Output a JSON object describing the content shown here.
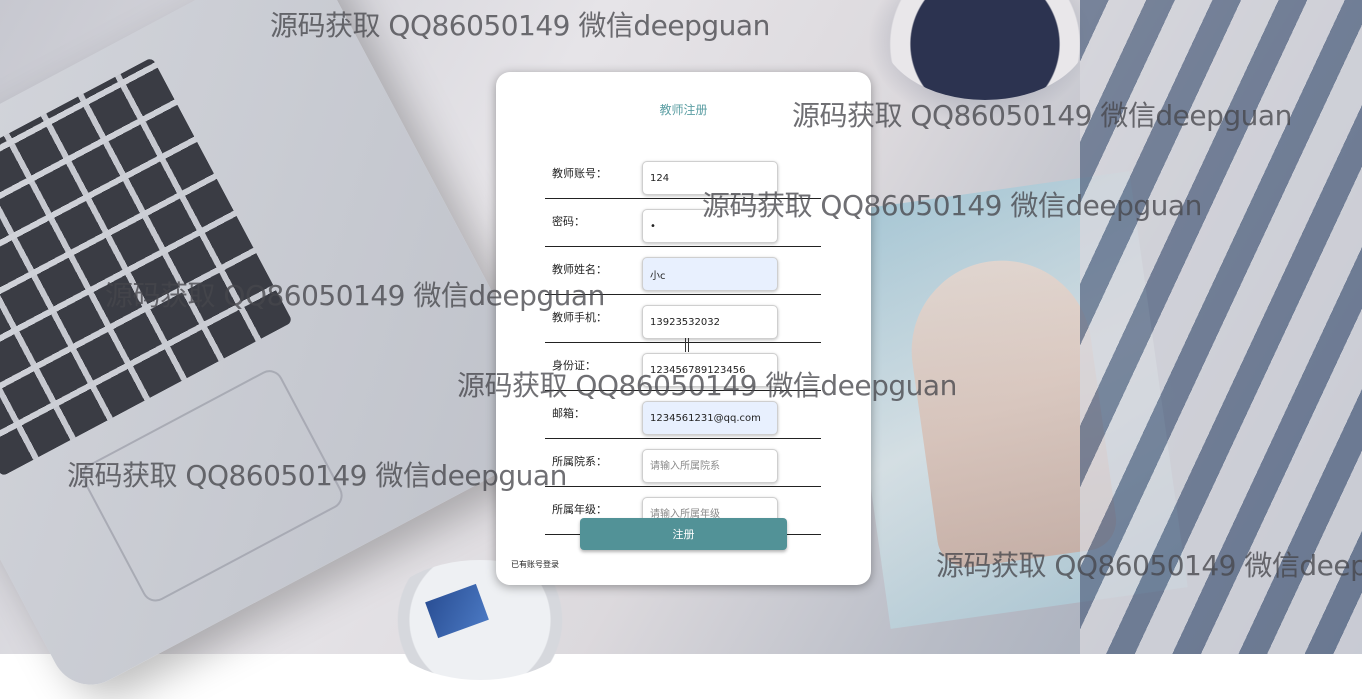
{
  "form": {
    "title": "教师注册",
    "fields": [
      {
        "label": "教师账号：",
        "value": "124",
        "placeholder": "",
        "type": "text"
      },
      {
        "label": "密码：",
        "value": "•",
        "placeholder": "",
        "type": "text"
      },
      {
        "label": "教师姓名：",
        "value": "小c",
        "placeholder": "",
        "type": "text"
      },
      {
        "label": "教师手机：",
        "value": "13923532032",
        "placeholder": "",
        "type": "text"
      },
      {
        "label": "身份证：",
        "value": "123456789123456",
        "placeholder": "",
        "type": "text"
      },
      {
        "label": "邮箱：",
        "value": "1234561231@qq.com",
        "placeholder": "",
        "type": "text"
      },
      {
        "label": "所属院系：",
        "value": "",
        "placeholder": "请输入所属院系",
        "type": "text"
      },
      {
        "label": "所属年级：",
        "value": "",
        "placeholder": "请输入所属年级",
        "type": "text"
      }
    ],
    "submit_label": "注册",
    "login_link": "已有账号登录"
  },
  "watermark": {
    "text": "源码获取 QQ86050149 微信deepguan"
  },
  "colors": {
    "accent": "#529297",
    "title": "#5b9ea3",
    "autofill": "#e8f0fe"
  }
}
